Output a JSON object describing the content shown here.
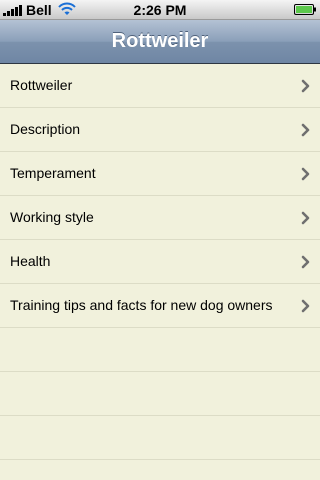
{
  "status_bar": {
    "carrier": "Bell",
    "time": "2:26 PM"
  },
  "nav": {
    "title": "Rottweiler"
  },
  "list": {
    "items": [
      {
        "label": "Rottweiler"
      },
      {
        "label": "Description"
      },
      {
        "label": "Temperament"
      },
      {
        "label": "Working style"
      },
      {
        "label": "Health"
      },
      {
        "label": "Training tips and facts for new dog owners"
      }
    ]
  },
  "colors": {
    "background": "#f1f1dc",
    "nav_bar": "#7c92ad",
    "separator": "#dcdcc6",
    "chevron": "#6f6f6f"
  }
}
